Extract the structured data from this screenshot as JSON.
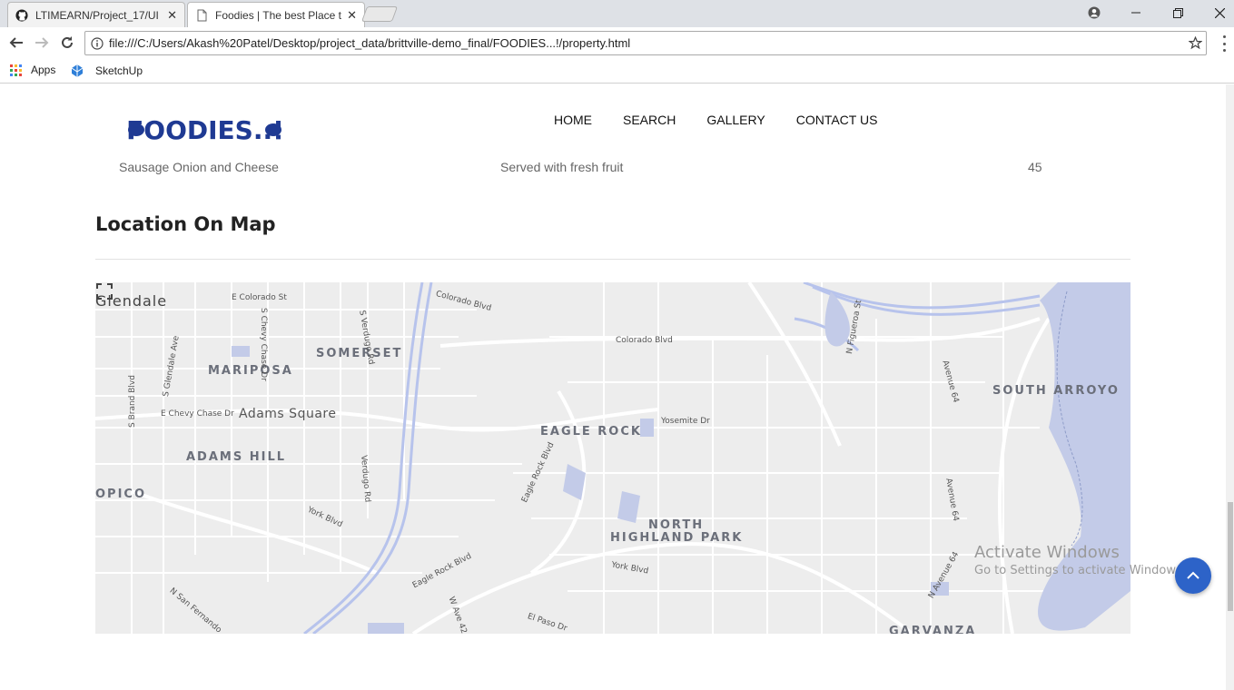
{
  "browser": {
    "tabs": [
      {
        "title": "LTIMEARN/Project_17/UI",
        "icon": "github-icon"
      },
      {
        "title": "Foodies | The best Place t",
        "icon": "page-icon"
      }
    ],
    "url": "file:///C:/Users/Akash%20Patel/Desktop/project_data/brittville-demo_final/FOODIES...!/property.html",
    "bookmarks": [
      {
        "label": "Apps",
        "icon": "apps-grid-icon"
      },
      {
        "label": "SketchUp",
        "icon": "sketchup-icon"
      }
    ]
  },
  "site": {
    "logo_text": "FOODIES..!",
    "nav": [
      "HOME",
      "SEARCH",
      "GALLERY",
      "CONTACT US"
    ]
  },
  "menu_row": {
    "item": "Sausage Onion and Cheese",
    "description": "Served with fresh fruit",
    "price": "45"
  },
  "location": {
    "title": "Location On Map"
  },
  "map": {
    "areas": {
      "glendale": "Glendale",
      "somerset": "SOMERSET",
      "mariposa": "MARIPOSA",
      "adams_square": "Adams Square",
      "adams_hill": "ADAMS HILL",
      "opico": "OPICO",
      "eagle_rock": "EAGLE ROCK",
      "north": "NORTH",
      "highland_park": "HIGHLAND PARK",
      "south_arroyo": "SOUTH ARROYO",
      "garvanza": "GARVANZA"
    },
    "streets": {
      "e_colorado_st": "E Colorado St",
      "s_chevy_chase": "S Chevy Chase Dr",
      "s_verdugo": "S Verdugo Rd",
      "colorado_blvd_1": "Colorado Blvd",
      "colorado_blvd_2": "Colorado Blvd",
      "n_figueroa": "N Figueroa St",
      "avenue_64_a": "Avenue 64",
      "s_glendale": "S Glendale Ave",
      "s_brand": "S Brand Blvd",
      "e_chevy_chase": "E Chevy Chase Dr",
      "yosemite": "Yosemite Dr",
      "eagle_rock_blvd_1": "Eagle Rock Blvd",
      "verdugo_rd": "Verdugo Rd",
      "avenue_64_b": "Avenue 64",
      "york_blvd_1": "York Blvd",
      "york_blvd_2": "York Blvd",
      "eagle_rock_blvd_2": "Eagle Rock Blvd",
      "n_avenue_64": "N Avenue 64",
      "n_san_fernando": "N San Fernando",
      "w_ave_42": "W Ave 42",
      "el_paso": "El Paso Dr"
    },
    "colors": {
      "land": "#ededed",
      "road": "#ffffff",
      "water": "#c3cbe8",
      "highway": "#b7c3ec"
    }
  },
  "watermark": {
    "title": "Activate Windows",
    "subtitle": "Go to Settings to activate Windows."
  }
}
